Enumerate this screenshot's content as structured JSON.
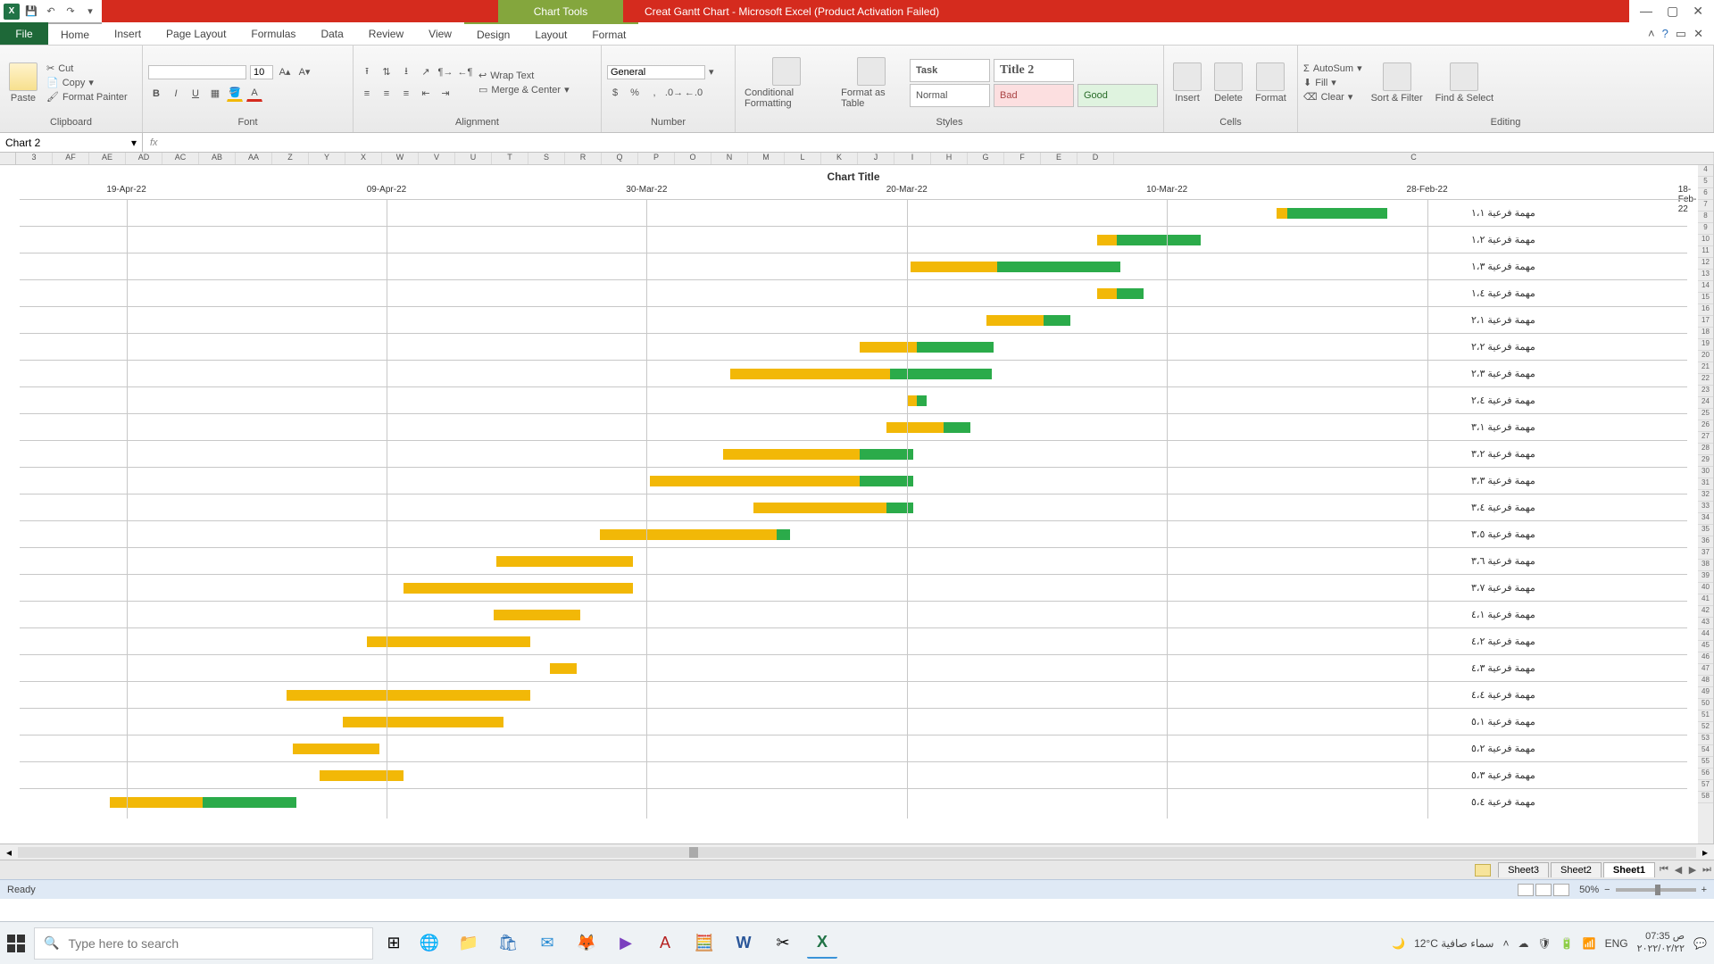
{
  "title_bar": {
    "chart_tools": "Chart Tools",
    "title": "Creat Gantt Chart - Microsoft Excel (Product Activation Failed)"
  },
  "tabs": {
    "file": "File",
    "items": [
      "Home",
      "Insert",
      "Page Layout",
      "Formulas",
      "Data",
      "Review",
      "View"
    ],
    "chart_items": [
      "Design",
      "Layout",
      "Format"
    ]
  },
  "ribbon": {
    "clipboard": {
      "paste": "Paste",
      "cut": "Cut",
      "copy": "Copy",
      "fp": "Format Painter",
      "label": "Clipboard"
    },
    "font": {
      "size": "10",
      "label": "Font"
    },
    "alignment": {
      "wrap": "Wrap Text",
      "merge": "Merge & Center",
      "label": "Alignment"
    },
    "number": {
      "format": "General",
      "label": "Number"
    },
    "styles": {
      "cond": "Conditional Formatting",
      "fas": "Format as Table",
      "cells": [
        "Task",
        "Title 2",
        "Normal",
        "Bad",
        "Good"
      ],
      "label": "Styles"
    },
    "cells": {
      "insert": "Insert",
      "delete": "Delete",
      "format": "Format",
      "label": "Cells"
    },
    "editing": {
      "autosum": "AutoSum",
      "fill": "Fill",
      "clear": "Clear",
      "sort": "Sort & Filter",
      "find": "Find & Select",
      "label": "Editing"
    }
  },
  "namebox": "Chart 2",
  "fx_label": "fx",
  "columns": [
    "3",
    "AF",
    "AE",
    "AD",
    "AC",
    "AB",
    "AA",
    "Z",
    "Y",
    "X",
    "W",
    "V",
    "U",
    "T",
    "S",
    "R",
    "Q",
    "P",
    "O",
    "N",
    "M",
    "L",
    "K",
    "J",
    "I",
    "H",
    "G",
    "F",
    "E",
    "D",
    "C"
  ],
  "row_numbers": [
    "4",
    "5",
    "6",
    "7",
    "8",
    "9",
    "10",
    "11",
    "12",
    "13",
    "14",
    "15",
    "16",
    "17",
    "18",
    "19",
    "20",
    "21",
    "22",
    "23",
    "24",
    "25",
    "26",
    "27",
    "28",
    "29",
    "30",
    "31",
    "32",
    "33",
    "34",
    "35",
    "36",
    "37",
    "38",
    "39",
    "40",
    "41",
    "42",
    "43",
    "44",
    "45",
    "46",
    "47",
    "48",
    "49",
    "50",
    "51",
    "52",
    "53",
    "54",
    "55",
    "56",
    "57",
    "58"
  ],
  "chart_data": {
    "type": "bar",
    "title": "Chart Title",
    "x_axis_dates": [
      "19-Apr-22",
      "09-Apr-22",
      "30-Mar-22",
      "20-Mar-22",
      "10-Mar-22",
      "28-Feb-22",
      "18-Feb-22"
    ],
    "x_axis_pos_pct": [
      6.4,
      22.0,
      37.6,
      53.2,
      68.8,
      84.4,
      100
    ],
    "gridlines_pct": [
      6.4,
      22.0,
      37.6,
      53.2,
      68.8,
      84.4
    ],
    "categories": [
      "مهمة فرعية ١،١",
      "مهمة فرعية ١،٢",
      "مهمة فرعية ١،٣",
      "مهمة فرعية ١،٤",
      "مهمة فرعية ٢،١",
      "مهمة فرعية ٢،٢",
      "مهمة فرعية ٢،٣",
      "مهمة فرعية ٢،٤",
      "مهمة فرعية ٣،١",
      "مهمة فرعية ٣،٢",
      "مهمة فرعية ٣،٣",
      "مهمة فرعية ٣،٤",
      "مهمة فرعية ٣،٥",
      "مهمة فرعية ٣،٦",
      "مهمة فرعية ٣،٧",
      "مهمة فرعية ٤،١",
      "مهمة فرعية ٤،٢",
      "مهمة فرعية ٤،٣",
      "مهمة فرعية ٤،٤",
      "مهمة فرعية ٥،١",
      "مهمة فرعية ٥،٢",
      "مهمة فرعية ٥،٣",
      "مهمة فرعية ٥،٤"
    ],
    "series_colors": {
      "orange": "#f2b807",
      "green": "#2bab4a"
    },
    "bars": [
      {
        "o_start": 75.4,
        "o_len": 0.6,
        "g_start": 76.0,
        "g_len": 6.0
      },
      {
        "o_start": 64.6,
        "o_len": 1.2,
        "g_start": 65.8,
        "g_len": 5.0
      },
      {
        "o_start": 53.4,
        "o_len": 5.2,
        "g_start": 58.6,
        "g_len": 7.4
      },
      {
        "o_start": 64.6,
        "o_len": 1.2,
        "g_start": 65.8,
        "g_len": 1.6
      },
      {
        "o_start": 58.0,
        "o_len": 3.4,
        "g_start": 61.4,
        "g_len": 1.6
      },
      {
        "o_start": 50.4,
        "o_len": 3.4,
        "g_start": 53.8,
        "g_len": 4.6
      },
      {
        "o_start": 42.6,
        "o_len": 9.6,
        "g_start": 52.2,
        "g_len": 6.1
      },
      {
        "o_start": 53.2,
        "o_len": 0.6,
        "g_start": 53.8,
        "g_len": 0.6
      },
      {
        "o_start": 52.0,
        "o_len": 3.4,
        "g_start": 55.4,
        "g_len": 1.6
      },
      {
        "o_start": 42.2,
        "o_len": 8.2,
        "g_start": 50.4,
        "g_len": 3.2
      },
      {
        "o_start": 37.8,
        "o_len": 12.6,
        "g_start": 50.4,
        "g_len": 3.2
      },
      {
        "o_start": 44.0,
        "o_len": 8.0,
        "g_start": 52.0,
        "g_len": 1.6
      },
      {
        "o_start": 34.8,
        "o_len": 10.6,
        "g_start": 45.4,
        "g_len": 0.8
      },
      {
        "o_start": 28.6,
        "o_len": 8.2,
        "g_start": 0,
        "g_len": 0
      },
      {
        "o_start": 23.0,
        "o_len": 13.8,
        "g_start": 0,
        "g_len": 0
      },
      {
        "o_start": 28.4,
        "o_len": 5.2,
        "g_start": 0,
        "g_len": 0
      },
      {
        "o_start": 20.8,
        "o_len": 9.8,
        "g_start": 0,
        "g_len": 0
      },
      {
        "o_start": 31.8,
        "o_len": 1.6,
        "g_start": 0,
        "g_len": 0
      },
      {
        "o_start": 16.0,
        "o_len": 14.6,
        "g_start": 0,
        "g_len": 0
      },
      {
        "o_start": 19.4,
        "o_len": 9.6,
        "g_start": 0,
        "g_len": 0
      },
      {
        "o_start": 16.4,
        "o_len": 5.2,
        "g_start": 0,
        "g_len": 0
      },
      {
        "o_start": 18.0,
        "o_len": 5.0,
        "g_start": 0,
        "g_len": 0
      },
      {
        "o_start": 5.4,
        "o_len": 5.6,
        "g_start": 11.0,
        "g_len": 5.6
      }
    ]
  },
  "sheets": {
    "s3": "Sheet3",
    "s2": "Sheet2",
    "s1": "Sheet1"
  },
  "statusbar": {
    "ready": "Ready",
    "zoom": "50%"
  },
  "taskbar": {
    "search_placeholder": "Type here to search",
    "weather": "12°C سماء صافية",
    "lang": "ENG",
    "time": "07:35 ص",
    "date": "٢٠٢٢/٠٢/٢٢"
  }
}
